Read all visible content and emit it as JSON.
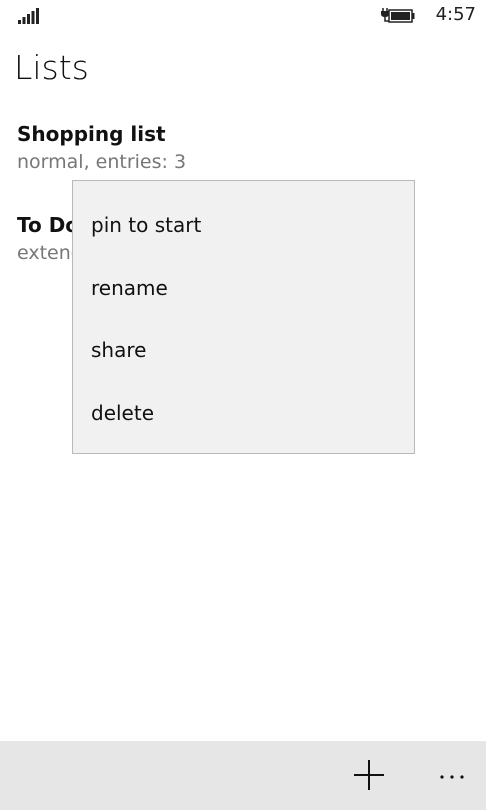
{
  "status": {
    "time": "4:57",
    "signal_icon": "signal-strength-icon",
    "battery_icon": "battery-charging-icon"
  },
  "page": {
    "title": "Lists"
  },
  "lists": [
    {
      "title": "Shopping list",
      "subtitle": "normal, entries: 3"
    },
    {
      "title": "To Do",
      "subtitle": "extenc"
    }
  ],
  "context_menu": {
    "items": [
      "pin to start",
      "rename",
      "share",
      "delete"
    ]
  },
  "app_bar": {
    "add_icon": "plus-icon",
    "more_icon": "ellipsis-icon"
  },
  "colors": {
    "background": "#ffffff",
    "menu_background": "#f1f1f1",
    "menu_border": "#b9b9b9",
    "app_bar": "#e6e6e6",
    "subtitle_text": "#777777"
  }
}
